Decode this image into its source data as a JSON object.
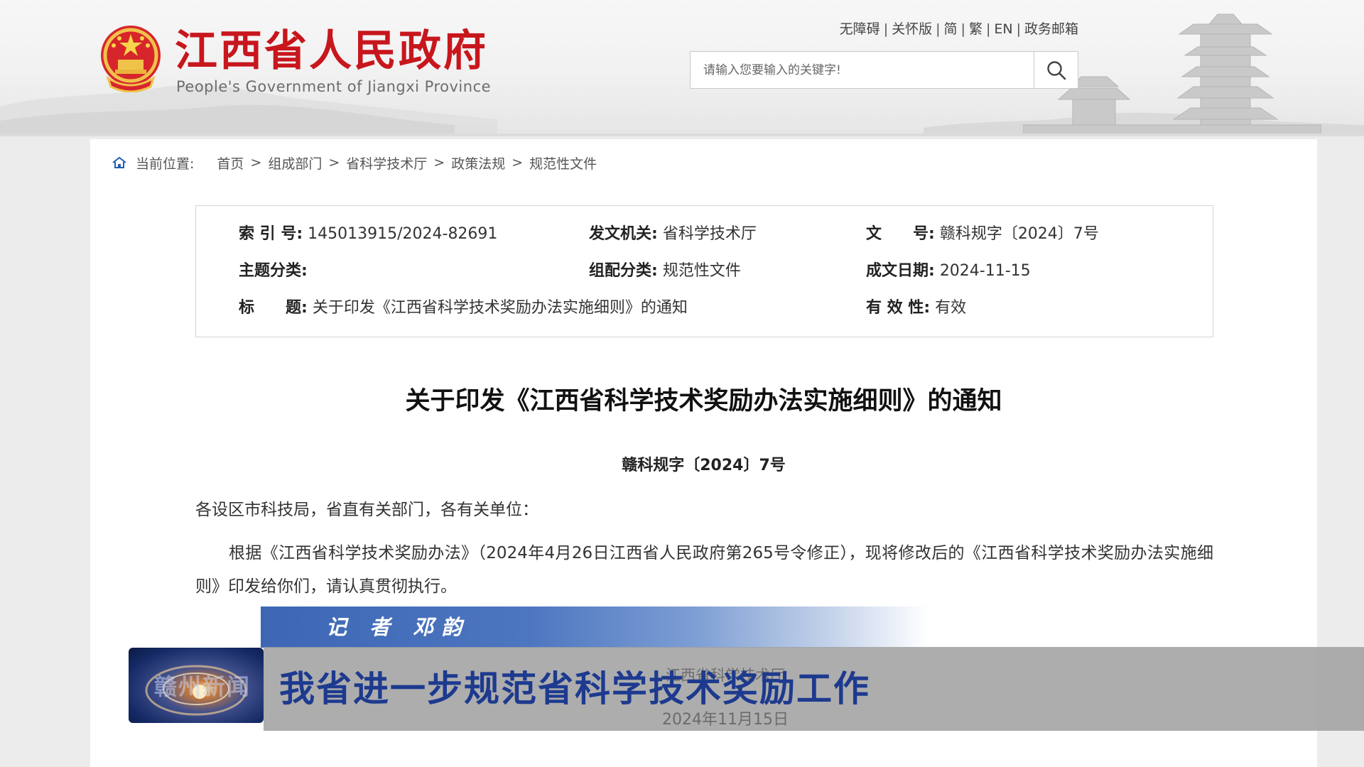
{
  "header": {
    "site_title": "江西省人民政府",
    "site_subtitle": "People's Government of Jiangxi Province",
    "top_links": [
      "无障碍",
      "关怀版",
      "简",
      "繁",
      "EN",
      "政务邮箱"
    ],
    "search": {
      "placeholder": "请输入您要输入的关键字!"
    },
    "icons": {
      "emblem": "national-emblem-icon",
      "search": "search-icon"
    },
    "brand_color": "#c8161d"
  },
  "breadcrumb": {
    "lead": "当前位置:",
    "items": [
      "首页",
      "组成部门",
      "省科学技术厅",
      "政策法规",
      "规范性文件"
    ],
    "separator": ">",
    "icon": "home-icon"
  },
  "meta": {
    "index_no": {
      "label": "索 引 号:",
      "value": "145013915/2024-82691"
    },
    "issuer": {
      "label": "发文机关:",
      "value": "省科学技术厅"
    },
    "doc_no": {
      "label": "文　　号:",
      "value": "赣科规字〔2024〕7号"
    },
    "topic": {
      "label": "主题分类:",
      "value": ""
    },
    "category": {
      "label": "组配分类:",
      "value": "规范性文件"
    },
    "date": {
      "label": "成文日期:",
      "value": "2024-11-15"
    },
    "title": {
      "label": "标　　题:",
      "value": "关于印发《江西省科学技术奖励办法实施细则》的通知"
    },
    "validity": {
      "label": "有 效 性:",
      "value": "有效"
    }
  },
  "document": {
    "title": "关于印发《江西省科学技术奖励办法实施细则》的通知",
    "number": "赣科规字〔2024〕7号",
    "greeting": "各设区市科技局，省直有关部门，各有关单位：",
    "paragraph": "根据《江西省科学技术奖励办法》（2024年4月26日江西省人民政府第265号令修正），现将修改后的《江西省科学技术奖励办法实施细则》印发给你们，请认真贯彻执行。"
  },
  "overlay": {
    "reporter": "记 者 邓韵",
    "headline": "我省进一步规范省科学技术奖励工作",
    "ghost_source": "江西省科学技术厅",
    "ghost_date": "2024年11月15日",
    "logo_text": "赣州新闻",
    "headline_color": "#1d3a8f",
    "reporter_bar_color": "#3d67b5"
  }
}
